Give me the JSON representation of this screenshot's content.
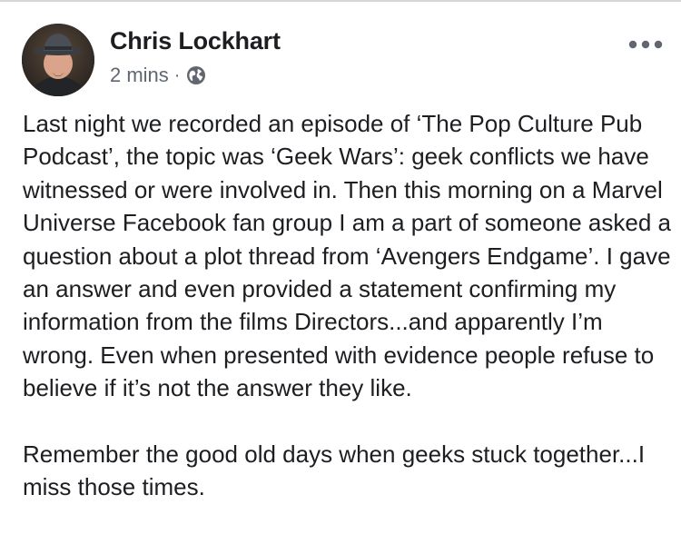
{
  "post": {
    "author": {
      "name": "Chris Lockhart"
    },
    "timestamp": "2 mins",
    "separator": "·",
    "audience_icon": "globe-icon",
    "more_icon": "more-options-icon",
    "paragraphs": [
      "Last night we recorded an episode of ‘The Pop Culture Pub Podcast’, the topic was ‘Geek Wars’: geek conflicts we have witnessed or were involved in. Then this morning on a Marvel Universe Facebook fan group I am a part of someone asked a question about a plot thread from ‘Avengers Endgame’. I gave an answer and even provided a statement confirming my information from the films Directors...and apparently I’m wrong. Even when presented with evidence people refuse to believe if it’s not the answer they like.",
      "Remember the good old days when geeks stuck together...I miss those times."
    ]
  },
  "colors": {
    "text_primary": "#1c1e21",
    "text_secondary": "#606770",
    "divider": "#d6d7da"
  }
}
